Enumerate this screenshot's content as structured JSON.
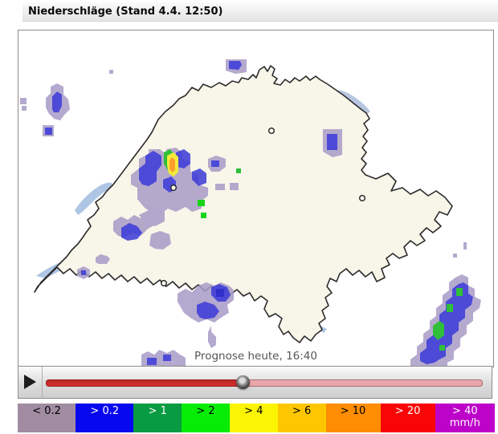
{
  "header": {
    "title": "Niederschläge (Stand 4.4. 12:50)"
  },
  "map": {
    "caption": "Prognose heute, 16:40"
  },
  "player": {
    "play_icon": "play-triangle",
    "slider_value_pct": 45.2,
    "track_fill_color_top": "#b82525",
    "track_fill_color": "#d83030",
    "track_rest_color": "#e9a7ac"
  },
  "legend": {
    "items": [
      {
        "label": "< 0.2",
        "sub": "",
        "bg": "#A18CA1",
        "fg": "#000000"
      },
      {
        "label": "> 0.2",
        "sub": "",
        "bg": "#0808EE",
        "fg": "#FFFFFF"
      },
      {
        "label": "> 1",
        "sub": "",
        "bg": "#089B41",
        "fg": "#FFFFFF"
      },
      {
        "label": "> 2",
        "sub": "",
        "bg": "#06EC06",
        "fg": "#000000"
      },
      {
        "label": "> 4",
        "sub": "",
        "bg": "#FBF402",
        "fg": "#000000"
      },
      {
        "label": "> 6",
        "sub": "",
        "bg": "#FEC601",
        "fg": "#000000"
      },
      {
        "label": "> 10",
        "sub": "",
        "bg": "#FE8D02",
        "fg": "#000000"
      },
      {
        "label": "> 20",
        "sub": "",
        "bg": "#FA0505",
        "fg": "#FFFFFF"
      },
      {
        "label": "> 40",
        "sub": "mm/h",
        "bg": "#BD02C9",
        "fg": "#FFFFFF"
      }
    ]
  }
}
